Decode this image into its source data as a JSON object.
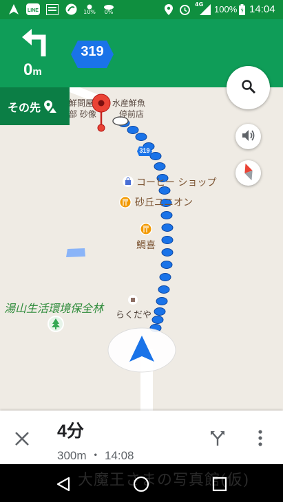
{
  "status_bar": {
    "network_label": "4G",
    "battery_percent": "100%",
    "time": "14:04",
    "weather_1_percent": "10%",
    "weather_2_percent": "0%",
    "icons": [
      "navigation-arrow-icon",
      "line-app-icon",
      "news-app-icon",
      "sync-icon",
      "weather-sun-icon",
      "weather-cloud-icon",
      "location-pin-icon",
      "alarm-icon",
      "signal-icon",
      "battery-icon"
    ]
  },
  "navigation": {
    "distance_value": "0",
    "distance_unit": "m",
    "maneuver_icon": "turn-left-icon",
    "route_number": "319",
    "then_label": "その先",
    "then_icon": "arrive-destination-icon",
    "header_color": "#0f9d58"
  },
  "map": {
    "destination_label_line1": "鮮問屋",
    "destination_label_line1b": "水産鮮魚",
    "destination_label_line2": "部 砂像",
    "destination_label_line2b": "停前店",
    "road_shield_small": "319",
    "pois": [
      {
        "name": "コーヒー ショップ",
        "icon": "shopping-bag-icon"
      },
      {
        "name": "砂丘ユニオン",
        "icon": "restaurant-icon"
      },
      {
        "name": "鯛喜",
        "icon": "restaurant-icon"
      },
      {
        "name": "らくだや",
        "icon": "poi-square-icon"
      }
    ],
    "park_label": "湯山生活環境保全林",
    "park_icon": "tree-icon",
    "route_color": "#1a73e8",
    "park_label_color": "#2e8b3a"
  },
  "buttons": {
    "search_icon": "search-icon",
    "volume_icon": "volume-icon",
    "compass_icon": "compass-icon"
  },
  "trip": {
    "eta_minutes": "4分",
    "eta_detail": "300m ・ 14:08",
    "close_icon": "close-icon",
    "alternate_routes_icon": "alternate-routes-icon",
    "more_icon": "more-vert-icon"
  },
  "android_nav": {
    "back_icon": "back-icon",
    "home_icon": "home-icon",
    "recents_icon": "recents-icon",
    "watermark": "大魔王さまの写真館(仮)"
  }
}
